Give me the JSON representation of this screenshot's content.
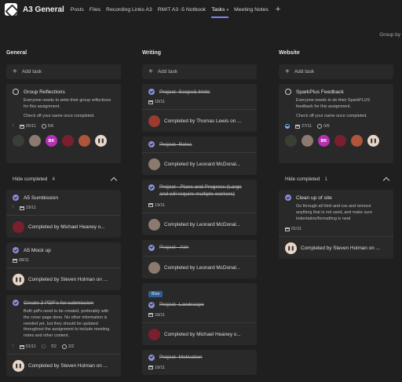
{
  "header": {
    "team_title": "A3 General",
    "tabs": [
      "Posts",
      "Files",
      "Recording Links A3",
      "RMIT A3 -5 Notbook",
      "Tasks",
      "Meeting Notes"
    ],
    "active_tab": "Tasks",
    "add_tab": "+",
    "group_by": "Group by"
  },
  "columns": {
    "general": {
      "title": "General",
      "add_task": "Add task",
      "cards": {
        "reflections": {
          "title": "Group Reflections",
          "desc1": "Everyone needs to write their group reflections for this assignment.",
          "desc2": "Check off your name once completed.",
          "date": "26/11",
          "checklist": "5/6"
        }
      },
      "hide_completed": "Hide completed",
      "completed_count": "4",
      "completed": {
        "a5_submission": {
          "title": "A5 Sumbission",
          "date": "19/11",
          "by": "Completed by Michael Heaney o..."
        },
        "a5_mockup": {
          "title": "A5 Mock up",
          "date": "08/11",
          "by": "Completed by Steven Holman on ..."
        },
        "create_pdfs": {
          "title": "Create 2 PDF's for submission",
          "desc": "Both pdf's need to be created, preferably with the cover page done. No other information is needed yet, but they should be updated throughout the assignment to include meeting notes and other content.",
          "date": "01/11",
          "attach": "2",
          "checklist": "2/2",
          "by": "Completed by Steven Holman on ..."
        }
      }
    },
    "writing": {
      "title": "Writing",
      "add_task": "Add task",
      "tasks": {
        "scope": {
          "title": "Project- Scope& limits",
          "date": "18/11",
          "by": "Completed by Thomas Lewis on ..."
        },
        "roles": {
          "title": "Project- Roles",
          "by": "Completed by Leonard McDonal..."
        },
        "plans": {
          "title": "Project - Plans and Progress (Large and will require multiple workers)",
          "date": "19/11",
          "by": "Completed by Leonard McDonal..."
        },
        "aim": {
          "title": "Project - Aim",
          "by": "Completed by Leonard McDonal..."
        },
        "landscape": {
          "label": "Blue",
          "title": "Project- Landscape",
          "date": "18/11",
          "by": "Completed by Michael Heaney o..."
        },
        "motivation": {
          "title": "Project- Motivation",
          "date": "18/11"
        }
      }
    },
    "website": {
      "title": "Website",
      "add_task": "Add task",
      "cards": {
        "sparkplus": {
          "title": "SparkPlus Feedback",
          "desc1": "Everyone needs to do their SparkPLUS feedback for this assignment.",
          "desc2": "Check off your name once completed.",
          "date": "27/11",
          "checklist": "0/6"
        }
      },
      "hide_completed": "Hide completed",
      "completed_count": "1",
      "completed": {
        "cleanup": {
          "title": "Clean up of site",
          "desc": "Go through all html and css and remove anything that is not used, and make sure indentation/formatting is neat",
          "date": "01/11",
          "by": "Completed by Steven Holman on ..."
        }
      }
    }
  },
  "avatar_initials": "BK",
  "colors": {
    "accent": "#7f85f5",
    "check": "#8b8fd9",
    "card": "#292929",
    "bg": "#1f1f1f",
    "bk": "#b431b4",
    "flag": "#e04f4f",
    "label_blue": "#2f5f8f"
  }
}
